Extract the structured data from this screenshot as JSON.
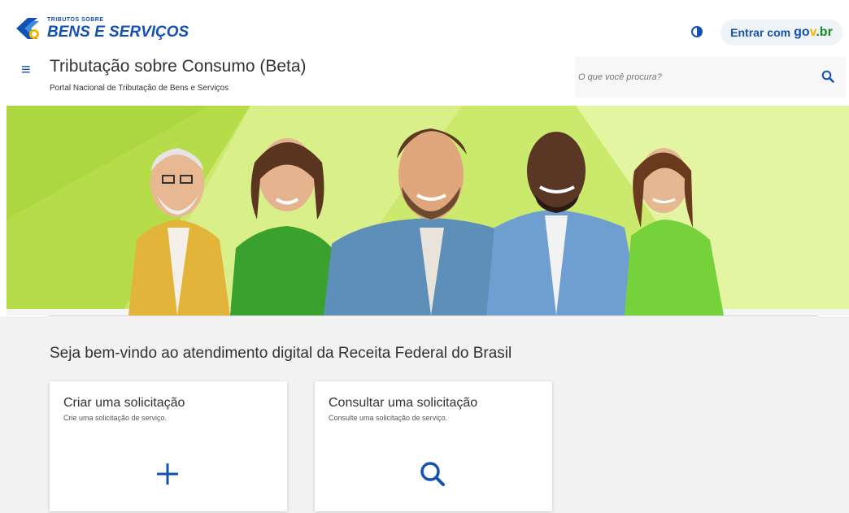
{
  "header": {
    "logo_small": "TRIBUTOS SOBRE",
    "logo_big": "BENS E SERVIÇOS",
    "login_label": "Entrar com",
    "govbr_g": "go",
    "govbr_v": "v",
    "govbr_br": ".br",
    "menu_icon": "hamburger-icon",
    "title": "Tributação sobre Consumo (Beta)",
    "subtitle": "Portal Nacional de Tributação de Bens e Serviços",
    "search_placeholder": "O que você procura?"
  },
  "hero": {
    "image": "banner of five smiling people on lime-green background"
  },
  "main": {
    "welcome": "Seja bem-vindo ao atendimento digital da Receita Federal do Brasil",
    "cards": [
      {
        "title": "Criar uma solicitação",
        "desc": "Crie uma solicitação de serviço.",
        "icon": "plus-icon"
      },
      {
        "title": "Consultar uma solicitação",
        "desc": "Consulte uma solicitação de serviço.",
        "icon": "search-icon"
      }
    ]
  },
  "colors": {
    "primary": "#1351b4",
    "hero_bg": "#c8e86a",
    "page_bg": "#f2f2f2"
  }
}
